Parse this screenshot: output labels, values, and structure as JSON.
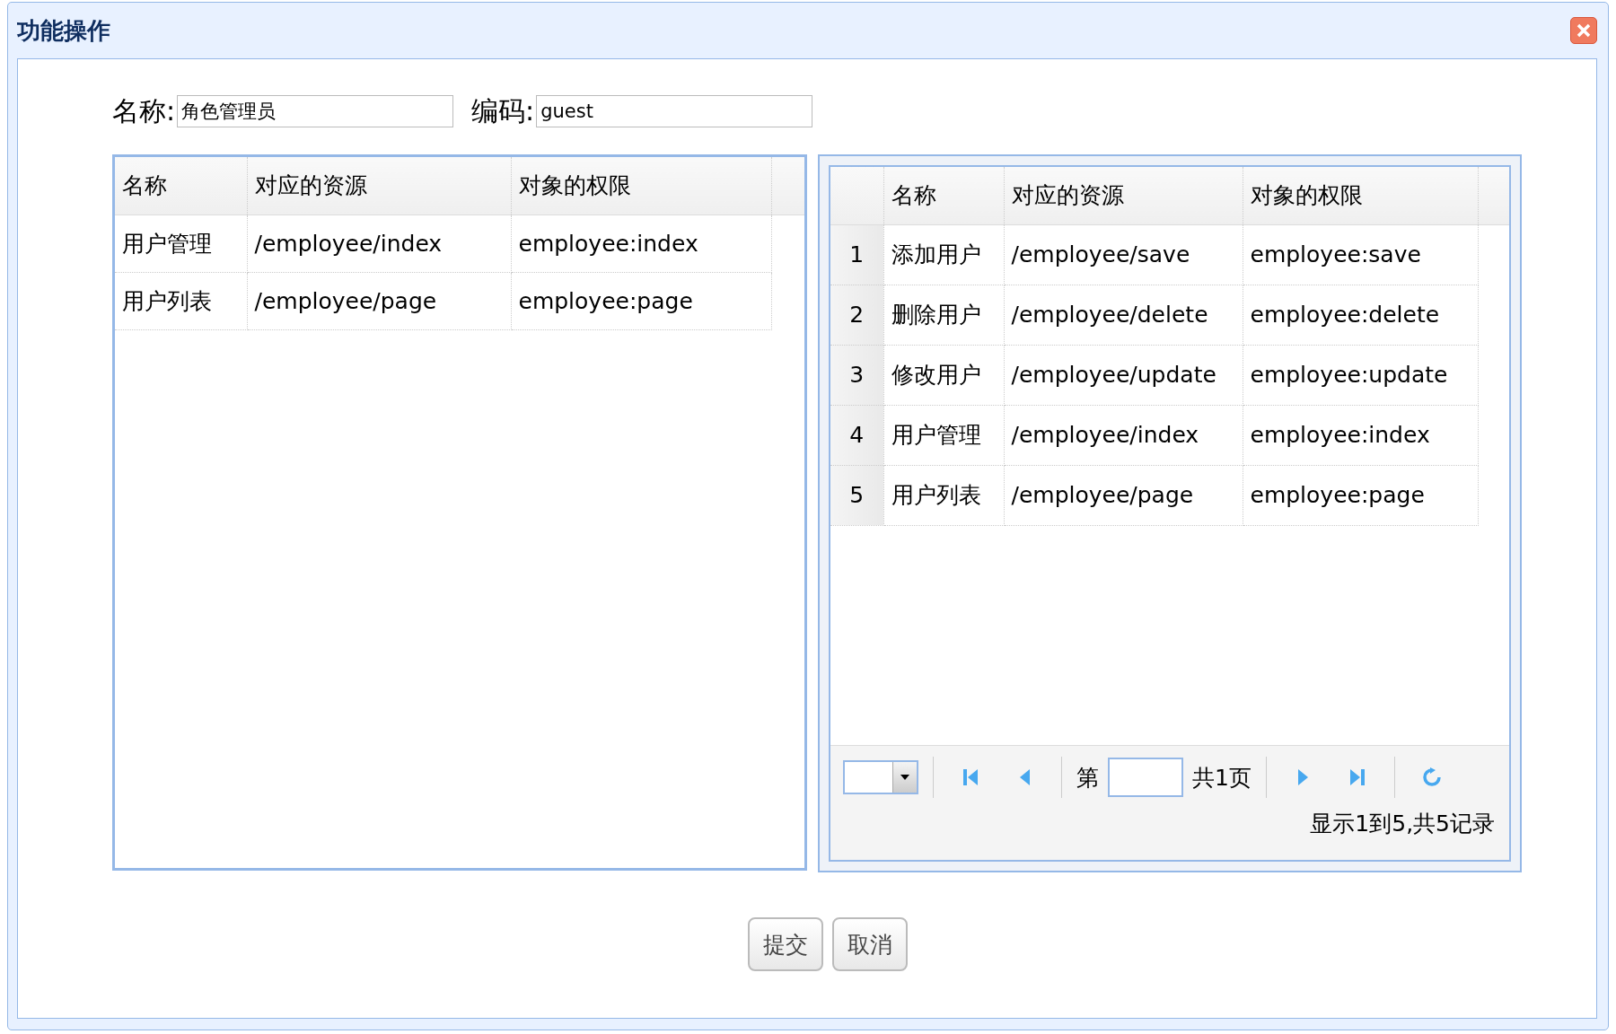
{
  "window": {
    "title": "功能操作"
  },
  "form": [
    {
      "label": "名称:",
      "value": "角色管理员"
    },
    {
      "label": "编码:",
      "value": "guest"
    }
  ],
  "selected_grid": {
    "columns": [
      "名称",
      "对应的资源",
      "对象的权限"
    ],
    "rows": [
      [
        "用户管理",
        "/employee/index",
        "employee:index"
      ],
      [
        "用户列表",
        "/employee/page",
        "employee:page"
      ]
    ]
  },
  "all_grid": {
    "columns": [
      "名称",
      "对应的资源",
      "对象的权限"
    ],
    "rows": [
      {
        "number": "1",
        "cells": [
          "添加用户",
          "/employee/save",
          "employee:save"
        ]
      },
      {
        "number": "2",
        "cells": [
          "删除用户",
          "/employee/delete",
          "employee:delete"
        ]
      },
      {
        "number": "3",
        "cells": [
          "修改用户",
          "/employee/update",
          "employee:update"
        ]
      },
      {
        "number": "4",
        "cells": [
          "用户管理",
          "/employee/index",
          "employee:index"
        ]
      },
      {
        "number": "5",
        "cells": [
          "用户列表",
          "/employee/page",
          "employee:page"
        ]
      }
    ]
  },
  "pagination": {
    "page_prefix": "第",
    "page_suffix": "共1页",
    "info": "显示1到5,共5记录"
  },
  "buttons": [
    "提交",
    "取消"
  ]
}
